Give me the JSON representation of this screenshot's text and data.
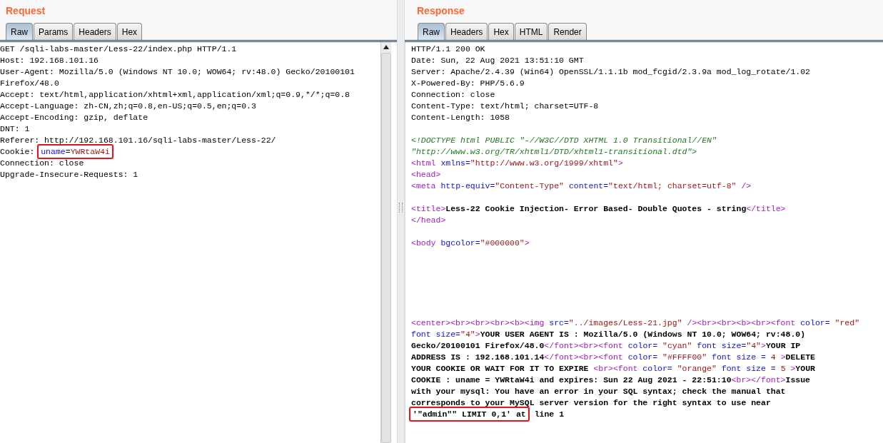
{
  "request": {
    "title": "Request",
    "tabs": [
      {
        "label": "Raw",
        "selected": true
      },
      {
        "label": "Params",
        "selected": false
      },
      {
        "label": "Headers",
        "selected": false
      },
      {
        "label": "Hex",
        "selected": false
      }
    ],
    "lines": [
      {
        "segments": [
          {
            "kind": "plain",
            "text": "GET /sqli-labs-master/Less-22/index.php HTTP/1.1"
          }
        ]
      },
      {
        "segments": [
          {
            "kind": "plain",
            "text": "Host: 192.168.101.16"
          }
        ]
      },
      {
        "segments": [
          {
            "kind": "plain",
            "text": "User-Agent: Mozilla/5.0 (Windows NT 10.0; WOW64; rv:48.0) Gecko/20100101"
          }
        ]
      },
      {
        "segments": [
          {
            "kind": "plain",
            "text": "Firefox/48.0"
          }
        ]
      },
      {
        "segments": [
          {
            "kind": "plain",
            "text": "Accept: text/html,application/xhtml+xml,application/xml;q=0.9,*/*;q=0.8"
          }
        ]
      },
      {
        "segments": [
          {
            "kind": "plain",
            "text": "Accept-Language: zh-CN,zh;q=0.8,en-US;q=0.5,en;q=0.3"
          }
        ]
      },
      {
        "segments": [
          {
            "kind": "plain",
            "text": "Accept-Encoding: gzip, deflate"
          }
        ]
      },
      {
        "segments": [
          {
            "kind": "plain",
            "text": "DNT: 1"
          }
        ]
      },
      {
        "segments": [
          {
            "kind": "plain",
            "text": "Referer: http://192.168.101.16/sqli-labs-master/Less-22/"
          }
        ]
      },
      {
        "segments": [
          {
            "kind": "plain",
            "text": "Cookie: "
          },
          {
            "kind": "box",
            "segments": [
              {
                "kind": "attr",
                "text": "uname"
              },
              {
                "kind": "plain",
                "text": "="
              },
              {
                "kind": "value",
                "text": "YWRtaW4i"
              }
            ]
          }
        ]
      },
      {
        "segments": [
          {
            "kind": "plain",
            "text": "Connection: close"
          }
        ]
      },
      {
        "segments": [
          {
            "kind": "plain",
            "text": "Upgrade-Insecure-Requests: 1"
          }
        ]
      }
    ]
  },
  "response": {
    "title": "Response",
    "tabs": [
      {
        "label": "Raw",
        "selected": true
      },
      {
        "label": "Headers",
        "selected": false
      },
      {
        "label": "Hex",
        "selected": false
      },
      {
        "label": "HTML",
        "selected": false
      },
      {
        "label": "Render",
        "selected": false
      }
    ],
    "lines": [
      {
        "segments": [
          {
            "kind": "plain",
            "text": "HTTP/1.1 200 OK"
          }
        ]
      },
      {
        "segments": [
          {
            "kind": "plain",
            "text": "Date: Sun, 22 Aug 2021 13:51:10 GMT"
          }
        ]
      },
      {
        "segments": [
          {
            "kind": "plain",
            "text": "Server: Apache/2.4.39 (Win64) OpenSSL/1.1.1b mod_fcgid/2.3.9a mod_log_rotate/1.02"
          }
        ]
      },
      {
        "segments": [
          {
            "kind": "plain",
            "text": "X-Powered-By: PHP/5.6.9"
          }
        ]
      },
      {
        "segments": [
          {
            "kind": "plain",
            "text": "Connection: close"
          }
        ]
      },
      {
        "segments": [
          {
            "kind": "plain",
            "text": "Content-Type: text/html; charset=UTF-8"
          }
        ]
      },
      {
        "segments": [
          {
            "kind": "plain",
            "text": "Content-Length: 1058"
          }
        ]
      },
      {
        "kind": "blank"
      },
      {
        "segments": [
          {
            "kind": "doctype",
            "text": "<!DOCTYPE html PUBLIC \"-//W3C//DTD XHTML 1.0 Transitional//EN\""
          }
        ]
      },
      {
        "segments": [
          {
            "kind": "doctype",
            "text": "\"http://www.w3.org/TR/xhtml1/DTD/xhtml1-transitional.dtd\">"
          }
        ]
      },
      {
        "segments": [
          {
            "kind": "tag",
            "text": "<html "
          },
          {
            "kind": "attr",
            "text": "xmlns="
          },
          {
            "kind": "value",
            "text": "\"http://www.w3.org/1999/xhtml\""
          },
          {
            "kind": "tag",
            "text": ">"
          }
        ]
      },
      {
        "segments": [
          {
            "kind": "tag",
            "text": "<head>"
          }
        ]
      },
      {
        "segments": [
          {
            "kind": "tag",
            "text": "<meta "
          },
          {
            "kind": "attr",
            "text": "http-equiv="
          },
          {
            "kind": "value",
            "text": "\"Content-Type\" "
          },
          {
            "kind": "attr",
            "text": "content="
          },
          {
            "kind": "value",
            "text": "\"text/html; charset=utf-8\" "
          },
          {
            "kind": "tag",
            "text": "/>"
          }
        ]
      },
      {
        "kind": "blank"
      },
      {
        "segments": [
          {
            "kind": "tag",
            "text": "<title>"
          },
          {
            "kind": "bold",
            "text": "Less-22 Cookie Injection- Error Based- Double Quotes - string"
          },
          {
            "kind": "tag",
            "text": "</title>"
          }
        ]
      },
      {
        "segments": [
          {
            "kind": "tag",
            "text": "</head>"
          }
        ]
      },
      {
        "kind": "blank"
      },
      {
        "segments": [
          {
            "kind": "tag",
            "text": "<body "
          },
          {
            "kind": "attr",
            "text": "bgcolor="
          },
          {
            "kind": "value",
            "text": "\"#000000\""
          },
          {
            "kind": "tag",
            "text": ">"
          }
        ]
      },
      {
        "kind": "blank"
      },
      {
        "kind": "blank"
      },
      {
        "kind": "blank"
      },
      {
        "kind": "blank"
      },
      {
        "kind": "blank"
      },
      {
        "kind": "blank"
      },
      {
        "segments": [
          {
            "kind": "tag",
            "text": "<center><br><br><br><b><img "
          },
          {
            "kind": "attr",
            "text": "src="
          },
          {
            "kind": "value",
            "text": "\"../images/Less-21.jpg\" "
          },
          {
            "kind": "tag",
            "text": "/><br><br><b><br><font "
          },
          {
            "kind": "attr",
            "text": "color= "
          },
          {
            "kind": "value",
            "text": "\"red\""
          }
        ]
      },
      {
        "segments": [
          {
            "kind": "attr",
            "text": "font size="
          },
          {
            "kind": "value",
            "text": "\"4\""
          },
          {
            "kind": "tag",
            "text": ">"
          },
          {
            "kind": "bold",
            "text": "YOUR USER AGENT IS : Mozilla/5.0 (Windows NT 10.0; WOW64; rv:48.0)"
          }
        ]
      },
      {
        "segments": [
          {
            "kind": "bold",
            "text": "Gecko/20100101 Firefox/48.0"
          },
          {
            "kind": "tag",
            "text": "</font><br><font "
          },
          {
            "kind": "attr",
            "text": "color= "
          },
          {
            "kind": "value",
            "text": "\"cyan\" "
          },
          {
            "kind": "attr",
            "text": "font size="
          },
          {
            "kind": "value",
            "text": "\"4\""
          },
          {
            "kind": "tag",
            "text": ">"
          },
          {
            "kind": "bold",
            "text": "YOUR IP"
          }
        ]
      },
      {
        "segments": [
          {
            "kind": "bold",
            "text": "ADDRESS IS : 192.168.101.14"
          },
          {
            "kind": "tag",
            "text": "</font><br><font "
          },
          {
            "kind": "attr",
            "text": "color= "
          },
          {
            "kind": "value",
            "text": "\"#FFFF00\" "
          },
          {
            "kind": "attr",
            "text": "font size = "
          },
          {
            "kind": "value",
            "text": "4 "
          },
          {
            "kind": "tag",
            "text": ">"
          },
          {
            "kind": "bold",
            "text": "DELETE"
          }
        ]
      },
      {
        "segments": [
          {
            "kind": "bold",
            "text": "YOUR COOKIE OR WAIT FOR IT TO EXPIRE "
          },
          {
            "kind": "tag",
            "text": "<br><font "
          },
          {
            "kind": "attr",
            "text": "color= "
          },
          {
            "kind": "value",
            "text": "\"orange\" "
          },
          {
            "kind": "attr",
            "text": "font size = "
          },
          {
            "kind": "value",
            "text": "5 "
          },
          {
            "kind": "tag",
            "text": ">"
          },
          {
            "kind": "bold",
            "text": "YOUR"
          }
        ]
      },
      {
        "segments": [
          {
            "kind": "bold",
            "text": "COOKIE : uname = YWRtaW4i and expires: Sun 22 Aug 2021 - 22:51:10"
          },
          {
            "kind": "tag",
            "text": "<br></font>"
          },
          {
            "kind": "bold",
            "text": "Issue"
          }
        ]
      },
      {
        "segments": [
          {
            "kind": "bold",
            "text": "with your mysql: You have an error in your SQL syntax; check the manual that"
          }
        ]
      },
      {
        "segments": [
          {
            "kind": "bold",
            "text": "corresponds to your MySQL server version for the right syntax to use near"
          }
        ]
      },
      {
        "segments": [
          {
            "kind": "box",
            "segments": [
              {
                "kind": "bold",
                "text": "'\"admin\"\" LIMIT 0,1' at"
              }
            ]
          },
          {
            "kind": "bold",
            "text": " line 1"
          }
        ]
      }
    ]
  }
}
